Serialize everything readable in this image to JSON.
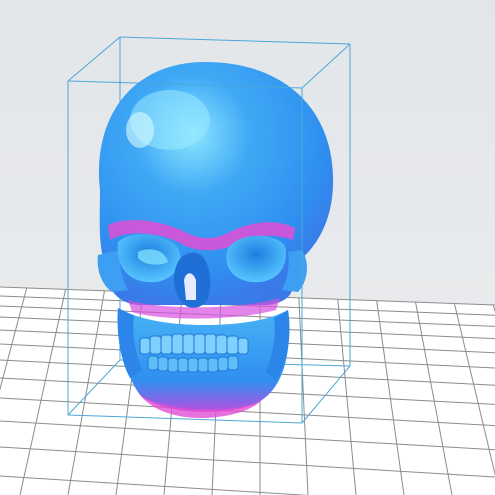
{
  "viewport": {
    "background_color": "#e6e9ec",
    "plate_color": "#ffffff",
    "grid_line_color": "#8c8c8c"
  },
  "model": {
    "name": "skull",
    "primary_color": "#3b9cf0",
    "highlight_color": "#6ed6ff",
    "shadow_color": "#e050d8"
  },
  "bounding_box": {
    "color": "#4aa7d8"
  }
}
